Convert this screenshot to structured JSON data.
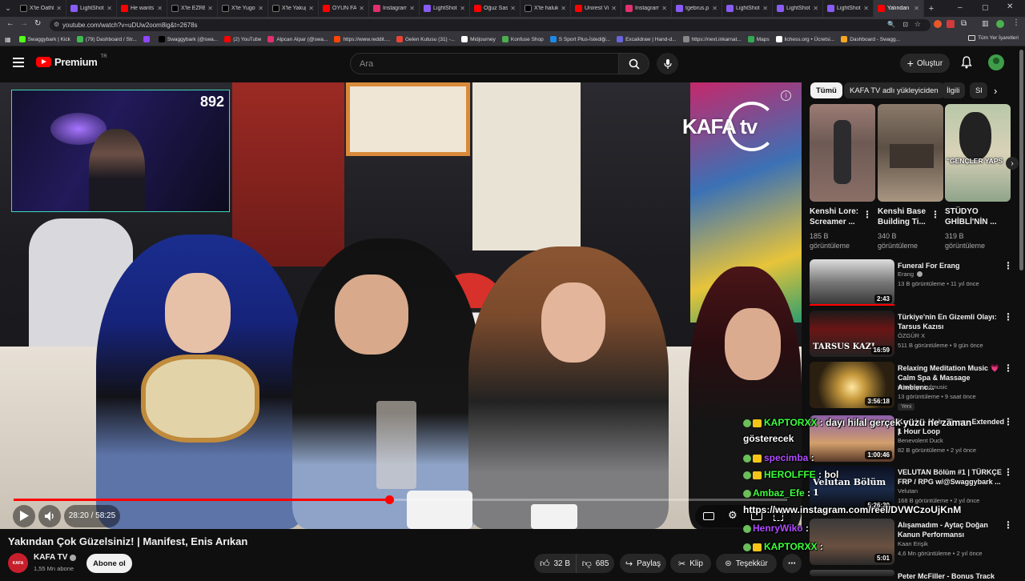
{
  "browser": {
    "tabs": [
      {
        "label": "X'te Oathb",
        "icon": "x-icon",
        "color": "#000000"
      },
      {
        "label": "LightShot",
        "icon": "lightshot-icon",
        "color": "#8a5cf6"
      },
      {
        "label": "He wants",
        "icon": "youtube-icon",
        "color": "#ff0000"
      },
      {
        "label": "X'te EZRE",
        "icon": "x-icon",
        "color": "#000000"
      },
      {
        "label": "X'te Yugo",
        "icon": "x-icon",
        "color": "#000000"
      },
      {
        "label": "X'te Yakup",
        "icon": "x-icon",
        "color": "#000000"
      },
      {
        "label": "OYUN FA",
        "icon": "youtube-icon",
        "color": "#ff0000"
      },
      {
        "label": "Instagram",
        "icon": "instagram-icon",
        "color": "#e1306c"
      },
      {
        "label": "LightShot",
        "icon": "lightshot-icon",
        "color": "#8a5cf6"
      },
      {
        "label": "Oğuz Sas",
        "icon": "youtube-icon",
        "color": "#ff0000"
      },
      {
        "label": "X'te haluk",
        "icon": "x-icon",
        "color": "#000000"
      },
      {
        "label": "Unirest Vi",
        "icon": "youtube-icon",
        "color": "#ff0000"
      },
      {
        "label": "Instagram",
        "icon": "instagram-icon",
        "color": "#e1306c"
      },
      {
        "label": "tgebrus.p",
        "icon": "lightshot-icon",
        "color": "#8a5cf6"
      },
      {
        "label": "LightShot",
        "icon": "lightshot-icon",
        "color": "#8a5cf6"
      },
      {
        "label": "LightShot",
        "icon": "lightshot-icon",
        "color": "#8a5cf6"
      },
      {
        "label": "LightShot",
        "icon": "lightshot-icon",
        "color": "#8a5cf6"
      },
      {
        "label": "Yalından",
        "icon": "youtube-icon",
        "color": "#ff0000",
        "active": true
      }
    ],
    "url": "youtube.com/watch?v=uDUw2oom8ig&t=2678s",
    "bookmarks": [
      {
        "label": "Swaggybark | Kick",
        "color": "#53fc18"
      },
      {
        "label": "(79) Dashboard / Str...",
        "color": "#3fb950"
      },
      {
        "label": "",
        "color": "#9146ff"
      },
      {
        "label": "Swaggybark (@swa...",
        "color": "#000000"
      },
      {
        "label": "(2) YouTube",
        "color": "#ff0000"
      },
      {
        "label": "Alpcan Alpar (@swa...",
        "color": "#e1306c"
      },
      {
        "label": "https://www.reddit....",
        "color": "#ff4500"
      },
      {
        "label": "Gelen Kutusu (31) -...",
        "color": "#ea4335"
      },
      {
        "label": "Midjourney",
        "color": "#ffffff"
      },
      {
        "label": "Konfuse Shop",
        "color": "#4caf50"
      },
      {
        "label": "S Sport Plus-İstediği...",
        "color": "#1e88e5"
      },
      {
        "label": "Excalidraw | Hand-d...",
        "color": "#6965db"
      },
      {
        "label": "https://next.inkarnat...",
        "color": "#888888"
      },
      {
        "label": "Maps",
        "color": "#34a853"
      },
      {
        "label": "lichess.org • Ücretsi...",
        "color": "#ffffff"
      },
      {
        "label": "Dashboard - Swagg...",
        "color": "#f5a623"
      }
    ],
    "all_bookmarks": "Tüm Yer İşaretleri"
  },
  "youtube": {
    "logo_text": "Premium",
    "logo_region": "TR",
    "search_placeholder": "Ara",
    "create_label": "Oluştur"
  },
  "player": {
    "brand_watermark": "KAFA tv",
    "current_time": "28:20",
    "duration": "58:25",
    "time_display": "28:20 / 58:25",
    "progress_fraction": 0.485,
    "webcam_counter": "892"
  },
  "video": {
    "title": "Yakından Çok Güzelsiniz! | Manifest, Enis Arıkan",
    "channel": "KAFA TV",
    "subscribers": "1,55 Mn abone",
    "subscribe_label": "Abone ol",
    "likes": "32 B",
    "dislikes": "685",
    "share_label": "Paylaş",
    "clip_label": "Klip",
    "thanks_label": "Teşekkür"
  },
  "chips": [
    "Tümü",
    "KAFA TV adlı yükleyiciden",
    "İlgili",
    "Sl"
  ],
  "shorts": [
    {
      "title": "Kenshi Lore: Screamer ...",
      "line1": "Kenshi Lore:",
      "line2": "Screamer ...",
      "views": "185 B",
      "views_label": "görüntüleme"
    },
    {
      "title": "Kenshi Base Building Ti...",
      "line1": "Kenshi Base",
      "line2": "Building Ti...",
      "views": "340 B",
      "views_label": "görüntüleme"
    },
    {
      "title": "STÜDYO GHİBLİ'NİN ...",
      "line1": "STÜDYO",
      "line2": "GHİBLİ'NİN ...",
      "views": "319 B",
      "views_label": "görüntüleme",
      "overlay": "\"GENÇLER YAPS"
    }
  ],
  "recommendations": [
    {
      "title1": "Funeral For Erang",
      "title2": "",
      "channel": "Erang",
      "verified": true,
      "meta": "13 B görüntüleme • 11 yıl önce",
      "duration": "2:43",
      "badge": ""
    },
    {
      "title1": "Türkiye'nin En Gizemli Olayı:",
      "title2": "Tarsus Kazısı",
      "channel": "ÖZGÜR X",
      "verified": false,
      "meta": "511 B görüntüleme • 9 gün önce",
      "duration": "16:59",
      "badge": "",
      "thumb_text": "TARSUS KAZI"
    },
    {
      "title1": "Relaxing Meditation Music 💗",
      "title2": "Calm Spa & Massage Ambienc...",
      "channel": "relaxingmindmusic",
      "verified": false,
      "meta": "13 görüntüleme • 9 saat önce",
      "duration": "3:56:18",
      "badge": "Yeni"
    },
    {
      "title1": "Kenshi - Main Theme Extended |",
      "title2": "1 Hour Loop",
      "channel": "Benevolent Duck",
      "verified": false,
      "meta": "82 B görüntüleme • 2 yıl önce",
      "duration": "1:00:46",
      "badge": ""
    },
    {
      "title1": "VELUTAN Bölüm #1 | TÜRKÇE",
      "title2": "FRP / RPG w/@Swaggybark ...",
      "channel": "Velutan",
      "verified": false,
      "meta": "168 B görüntüleme • 2 yıl önce",
      "duration": "5:26:30",
      "badge": "",
      "thumb_text": "Velutan Bölüm 1"
    },
    {
      "title1": "Alışamadım - Aytaç Doğan",
      "title2": "Kanun Performansı",
      "channel": "Kaan Erişik",
      "verified": false,
      "meta": "4,6 Mn görüntüleme • 2 yıl önce",
      "duration": "5:01",
      "badge": ""
    },
    {
      "title1": "Peter McFiller - Bonus Track",
      "title2": "",
      "channel": "",
      "verified": false,
      "meta": "",
      "duration": "",
      "badge": ""
    }
  ],
  "chat": [
    {
      "user": "KAPTORXX",
      "color": "#3cff3c",
      "message": "dayı hilal gerçek yüzü ne zaman"
    },
    {
      "user": "",
      "color": "#ffffff",
      "message": "gösterecek"
    },
    {
      "user": "specimba",
      "color": "#b04cff",
      "message": ""
    },
    {
      "user": "HEROLFFE",
      "color": "#3cff3c",
      "message": "bol"
    },
    {
      "user": "Ambaz_Efe",
      "color": "#3cff3c",
      "message": ""
    },
    {
      "user": "",
      "color": "#ffffff",
      "message": "https://www.instagram.com/reel/DVWCzoUjKnM"
    },
    {
      "user": "HenryWiko",
      "color": "#b04cff",
      "message": ""
    },
    {
      "user": "KAPTORXX",
      "color": "#3cff3c",
      "message": ""
    }
  ]
}
